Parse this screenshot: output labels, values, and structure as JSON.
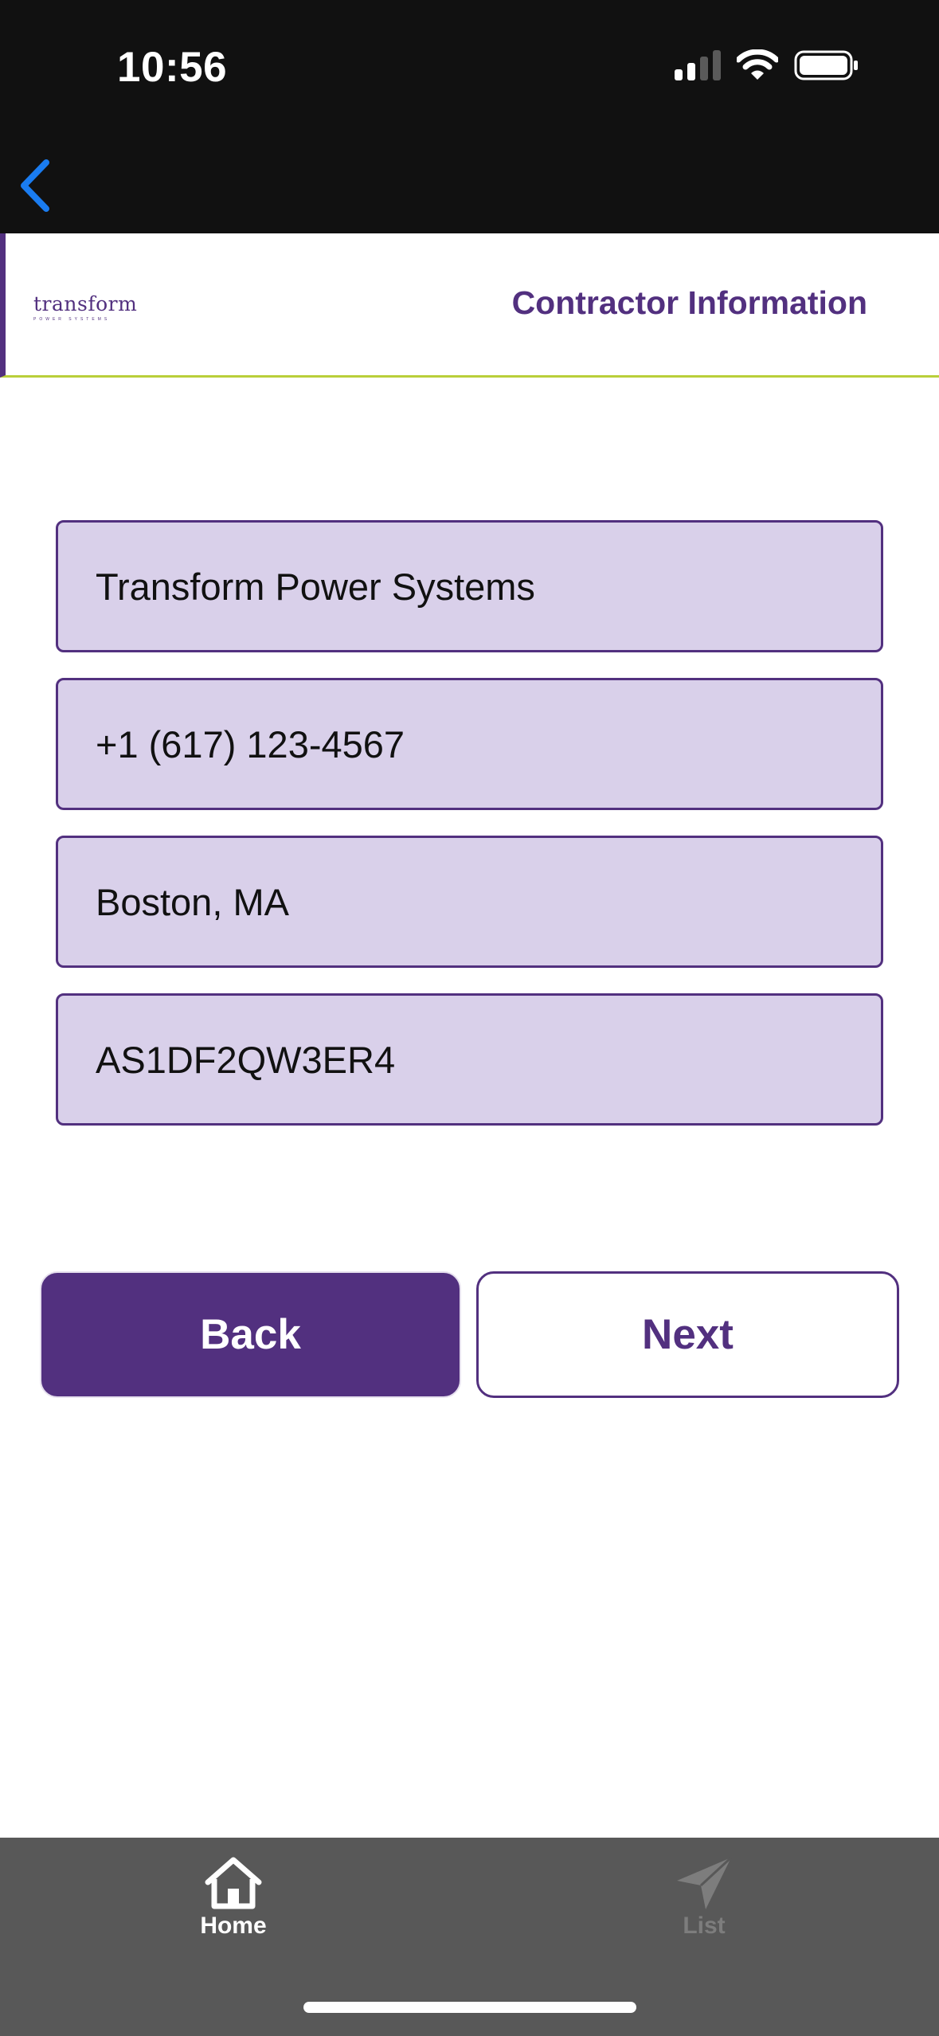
{
  "status_bar": {
    "time": "10:56"
  },
  "header": {
    "logo_text": "transform",
    "logo_subtext": "POWER SYSTEMS",
    "title": "Contractor Information",
    "brand_color": "#52307f",
    "accent_color": "#b9cf3a"
  },
  "form": {
    "fields": [
      {
        "value": "Transform Power Systems"
      },
      {
        "value": "+1 (617) 123-4567"
      },
      {
        "value": "Boston, MA"
      },
      {
        "value": "AS1DF2QW3ER4"
      }
    ]
  },
  "buttons": {
    "back_label": "Back",
    "next_label": "Next"
  },
  "tabbar": {
    "items": [
      {
        "label": "Home",
        "icon": "home-icon",
        "active": true
      },
      {
        "label": "List",
        "icon": "paper-plane-icon",
        "active": false
      }
    ]
  }
}
